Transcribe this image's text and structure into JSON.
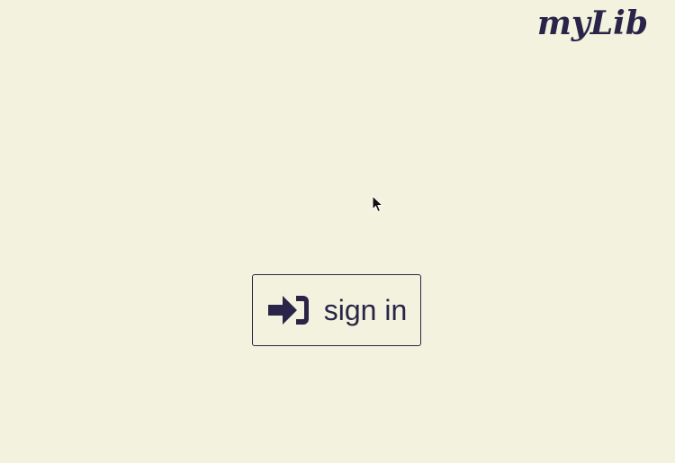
{
  "app": {
    "logo_text": "myLib"
  },
  "auth": {
    "signin_label": "sign in",
    "signin_icon": "sign-in-icon"
  },
  "colors": {
    "background": "#f2f2de",
    "primary": "#2a2548"
  }
}
